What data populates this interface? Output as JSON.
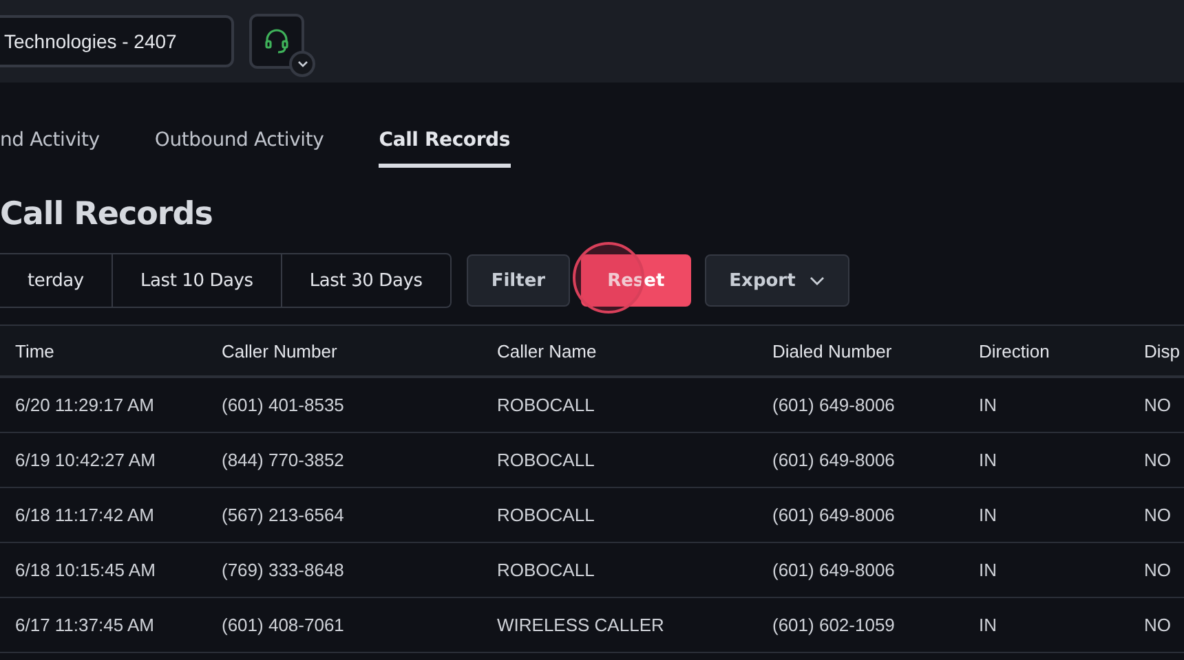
{
  "top_bar": {
    "account_field": {
      "value": "Technologies - 2407"
    }
  },
  "tabs": [
    {
      "label": "nd Activity",
      "selected": false
    },
    {
      "label": "Outbound Activity",
      "selected": false
    },
    {
      "label": "Call Records",
      "selected": true
    }
  ],
  "heading": "Call Records",
  "range_buttons": [
    "terday",
    "Last 10 Days",
    "Last 30 Days"
  ],
  "actions": [
    {
      "label": "Filter",
      "kind": "plain"
    },
    {
      "label": "Reset",
      "kind": "danger"
    },
    {
      "label": "Export",
      "kind": "menu"
    }
  ],
  "table": {
    "columns": [
      "Time",
      "Caller Number",
      "Caller Name",
      "Dialed Number",
      "Direction",
      "Disp"
    ],
    "rows": [
      [
        "6/20 11:29:17 AM",
        "(601) 401-8535",
        "ROBOCALL",
        "(601) 649-8006",
        "IN",
        "NO"
      ],
      [
        "6/19 10:42:27 AM",
        "(844) 770-3852",
        "ROBOCALL",
        "(601) 649-8006",
        "IN",
        "NO"
      ],
      [
        "6/18 11:17:42 AM",
        "(567) 213-6564",
        "ROBOCALL",
        "(601) 649-8006",
        "IN",
        "NO"
      ],
      [
        "6/18 10:15:45 AM",
        "(769) 333-8648",
        "ROBOCALL",
        "(601) 649-8006",
        "IN",
        "NO"
      ],
      [
        "6/17 11:37:45 AM",
        "(601) 408-7061",
        "WIRELESS CALLER",
        "(601) 602-1059",
        "IN",
        "NO"
      ]
    ]
  }
}
